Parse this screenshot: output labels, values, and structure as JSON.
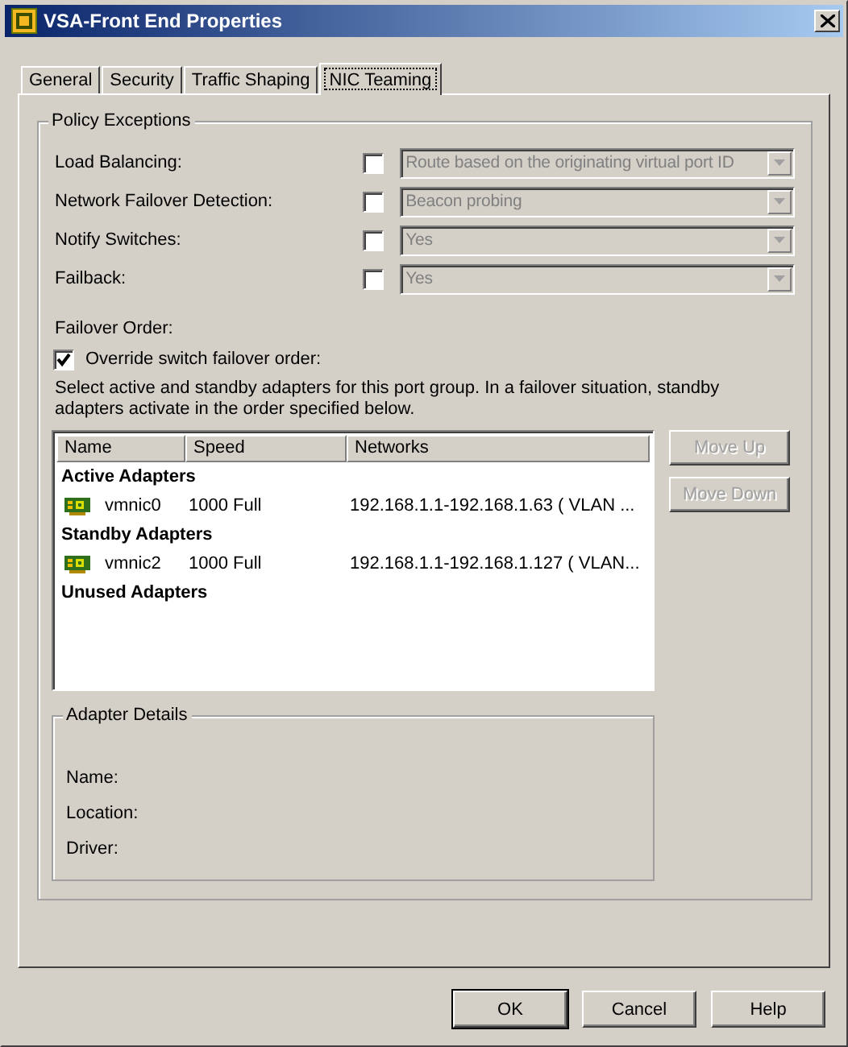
{
  "window": {
    "title": "VSA-Front End Properties"
  },
  "tabs": [
    {
      "label": "General",
      "selected": false
    },
    {
      "label": "Security",
      "selected": false
    },
    {
      "label": "Traffic Shaping",
      "selected": false
    },
    {
      "label": "NIC Teaming",
      "selected": true
    }
  ],
  "policy_exceptions": {
    "title": "Policy Exceptions",
    "rows": [
      {
        "label": "Load Balancing:",
        "checked": false,
        "value": "Route based on the originating virtual port ID",
        "disabled": true
      },
      {
        "label": "Network Failover Detection:",
        "checked": false,
        "value": "Beacon probing",
        "disabled": true
      },
      {
        "label": "Notify Switches:",
        "checked": false,
        "value": "Yes",
        "disabled": true
      },
      {
        "label": "Failback:",
        "checked": false,
        "value": "Yes",
        "disabled": true
      }
    ]
  },
  "failover_order": {
    "label": "Failover Order:",
    "override": {
      "label": "Override switch failover order:",
      "checked": true
    },
    "description": "Select active and standby adapters for this port group.  In a failover situation, standby adapters activate  in the order specified below.",
    "table": {
      "columns": [
        "Name",
        "Speed",
        "Networks"
      ],
      "rows": [
        {
          "kind": "group",
          "label": "Active Adapters"
        },
        {
          "kind": "adapter",
          "name": "vmnic0",
          "speed": "1000 Full",
          "networks": "192.168.1.1-192.168.1.63 ( VLAN ..."
        },
        {
          "kind": "group",
          "label": "Standby Adapters"
        },
        {
          "kind": "adapter",
          "name": "vmnic2",
          "speed": "1000 Full",
          "networks": "192.168.1.1-192.168.1.127 ( VLAN..."
        },
        {
          "kind": "group",
          "label": "Unused Adapters"
        }
      ]
    },
    "side_buttons": [
      {
        "label": "Move Up",
        "disabled": true
      },
      {
        "label": "Move Down",
        "disabled": true
      }
    ],
    "adapter_details": {
      "title": "Adapter Details",
      "fields": [
        "Name:",
        "Location:",
        "Driver:"
      ]
    }
  },
  "buttons": [
    {
      "label": "OK",
      "default": true
    },
    {
      "label": "Cancel",
      "default": false
    },
    {
      "label": "Help",
      "default": false
    }
  ]
}
